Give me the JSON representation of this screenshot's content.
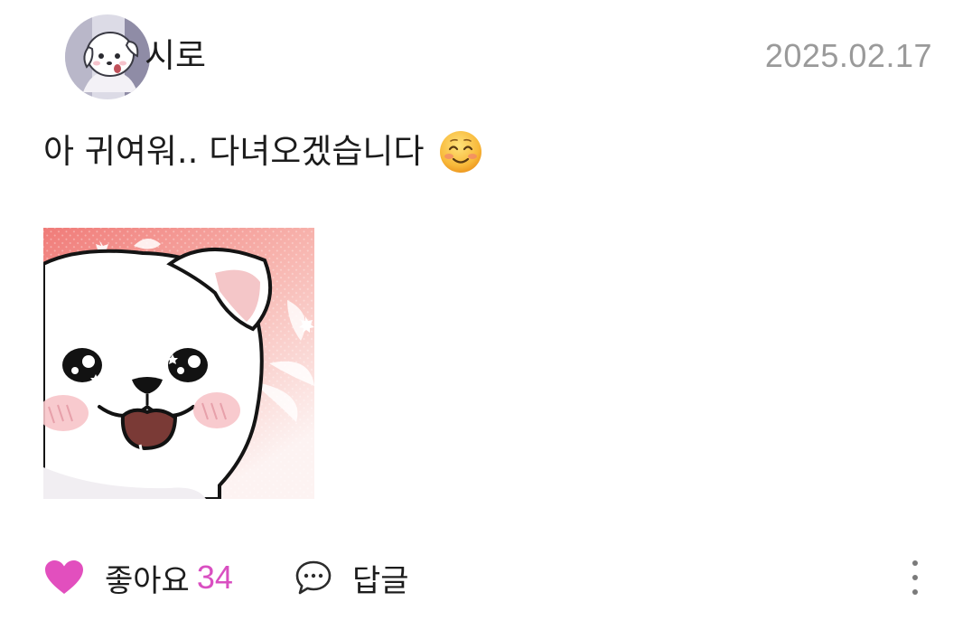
{
  "post": {
    "author": {
      "name": "시로",
      "avatar_icon": "white-puppy-avatar"
    },
    "date": "2025.02.17",
    "text": "아 귀여워.. 다녀오겠습니다",
    "emoji": "smiling-face-with-smiling-eyes",
    "image_icon": "white-puppy-sticker"
  },
  "actions": {
    "like": {
      "icon": "heart-icon",
      "label": "좋아요",
      "count": "34",
      "color": "#e24fbe"
    },
    "reply": {
      "icon": "speech-bubble-icon",
      "label": "답글"
    },
    "more": {
      "icon": "more-vertical-icon"
    }
  },
  "colors": {
    "date": "#9a9a9a",
    "like_count": "#d94fc1",
    "text": "#1c1c1c"
  }
}
